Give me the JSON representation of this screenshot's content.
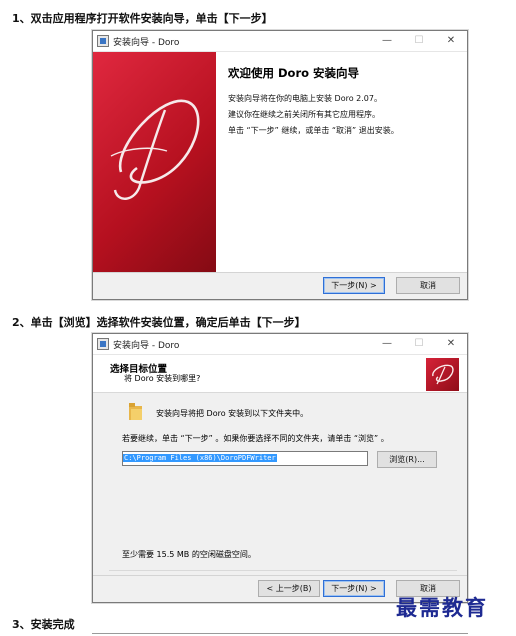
{
  "steps": {
    "s1": "1、双击应用程序打开软件安装向导，单击【下一步】",
    "s2": "2、单击【浏览】选择软件安装位置，确定后单击【下一步】",
    "s3": "3、安装完成"
  },
  "window": {
    "title": "安装向导 - Doro",
    "min": "—",
    "max": "☐",
    "close": "✕"
  },
  "welcome": {
    "heading": "欢迎使用 Doro 安装向导",
    "line1": "安装向导将在你的电脑上安装 Doro 2.07。",
    "line2": "建议你在继续之前关闭所有其它应用程序。",
    "line3": "单击 “下一步” 继续，或单击 “取消” 退出安装。",
    "next": "下一步(N) >",
    "cancel": "取消",
    "banner_letter": "D"
  },
  "select": {
    "title": "选择目标位置",
    "subtitle": "将 Doro 安装到哪里?",
    "install_to": "安装向导将把 Doro 安装到以下文件夹中。",
    "instruction": "若要继续，单击 “下一步” 。如果你要选择不同的文件夹，请单击 “浏览” 。",
    "path": "C:\\Program Files (x86)\\DoroPDFWriter",
    "browse": "浏览(R)...",
    "space": "至少需要 15.5 MB 的空闲磁盘空间。",
    "back": "< 上一步(B)",
    "next": "下一步(N) >",
    "cancel": "取消",
    "logo_letter": "D"
  },
  "watermark": "最需教育",
  "colors": {
    "banner": "#c0141f",
    "focus_border": "#2f6fd6",
    "selection": "#3399ff",
    "watermark": "#1e2a92"
  }
}
